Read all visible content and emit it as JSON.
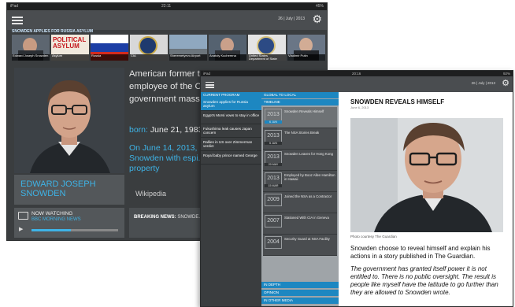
{
  "back_device": {
    "status": {
      "left": "iPad",
      "time": "22:11",
      "battery": "45%"
    },
    "date": "26 | July | 2013",
    "strip_label": "SNOWDEN APPLIES FOR RUSSIA ASYLUM",
    "thumbnails": [
      {
        "caption": "Edward Joseph Snowden"
      },
      {
        "caption": "Asylum",
        "overlay_text": "POLITICAL ASYLUM"
      },
      {
        "caption": "Russia"
      },
      {
        "caption": "CIA"
      },
      {
        "caption": "Sheremetyevo Airport"
      },
      {
        "caption": "Anatoly Kucherena"
      },
      {
        "caption": "United States Department of State"
      },
      {
        "caption": "Vladimir Putin"
      }
    ],
    "bio_text": "American former tech... States National Secu... employee of the Cen... leaked details of sev... government mass su...",
    "born_label": "born:",
    "born_value": "June 21, 1983",
    "on_text": "On June 14, 2013, ... Snowden with espi... property",
    "name": "EDWARD JOSEPH SNOWDEN",
    "source": "Wikipedia",
    "now_watching_label": "NOW WATCHING",
    "now_watching_program": "BBC MORNING NEWS",
    "progress_fraction": 0.45,
    "breaking_label": "BREAKING NEWS:",
    "breaking_text": "SNOWDE..."
  },
  "front_device": {
    "status": {
      "left": "iPad",
      "time": "20:16",
      "battery": "92%"
    },
    "date": "26 | July | 2013",
    "current_program_label": "CURRENT PROGRAM",
    "programs": [
      "Snowden applies for Russia asylum",
      "Egypt's Morsi vows to stay in office",
      "Fukushima leak causes Japan concern",
      "Rallies in US over Zimmerman verdict",
      "Royal baby prince named George"
    ],
    "tabs": {
      "global_to_local": "GLOBAL TO LOCAL",
      "timeline": "TIMELINE",
      "in_depth": "IN DEPTH",
      "opinion": "OPINION",
      "in_other_media": "IN OTHER MEDIA"
    },
    "timeline": [
      {
        "year": "2013",
        "date": "6 JUN",
        "text": "Snowden Reveals Himself"
      },
      {
        "year": "2013",
        "date": "5 JUN",
        "text": "The NSA Stories Break"
      },
      {
        "year": "2013",
        "date": "20 MAY",
        "text": "Snowden Leaves for Hong Kong"
      },
      {
        "year": "2013",
        "date": "15 MAR",
        "text": "Employed by Booz Allen Hamilton in Hawaii"
      },
      {
        "year": "2009",
        "date": "",
        "text": "Joined the NSA as a Contractor"
      },
      {
        "year": "2007",
        "date": "",
        "text": "Stationed With CIA in Geneva"
      },
      {
        "year": "2004",
        "date": "",
        "text": "Security Guard at NSA Facility"
      }
    ],
    "article": {
      "title": "SNOWDEN REVEALS HIMSELF",
      "date": "June 6, 2013",
      "photo_caption": "Photo courtesy The Guardian",
      "paragraph": "Snowden choose to reveal himself and explain his actions in a story published in The Guardian.",
      "quote": "The government has granted itself power it is not entitled to. There is no public oversight. The result is people like myself have the latitude to go further than they are allowed to Snowden wrote."
    }
  }
}
